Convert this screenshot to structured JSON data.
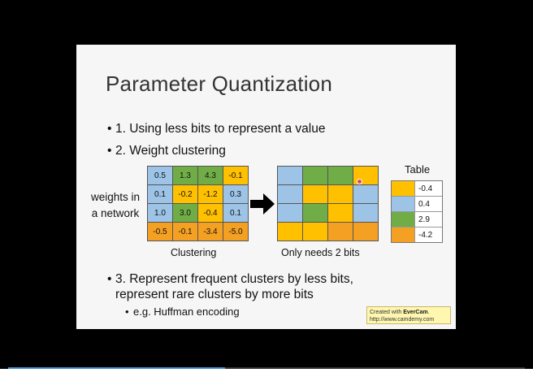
{
  "slide": {
    "title": "Parameter Quantization",
    "bullets": [
      "1. Using less bits to represent a value",
      "2. Weight clustering",
      "3. Represent frequent clusters by less bits,",
      "represent rare clusters by more bits"
    ],
    "sub_bullet": "e.g. Huffman encoding",
    "weights_label_line1": "weights in",
    "weights_label_line2": "a network",
    "clustering_caption": "Clustering",
    "bits_caption": "Only needs 2 bits",
    "table_title": "Table"
  },
  "weights_grid": [
    [
      {
        "v": "0.5",
        "c": "blue"
      },
      {
        "v": "1.3",
        "c": "green"
      },
      {
        "v": "4.3",
        "c": "green"
      },
      {
        "v": "-0.1",
        "c": "yellow"
      }
    ],
    [
      {
        "v": "0.1",
        "c": "blue"
      },
      {
        "v": "-0.2",
        "c": "yellow"
      },
      {
        "v": "-1.2",
        "c": "yellow"
      },
      {
        "v": "0.3",
        "c": "blue"
      }
    ],
    [
      {
        "v": "1.0",
        "c": "blue"
      },
      {
        "v": "3.0",
        "c": "green"
      },
      {
        "v": "-0.4",
        "c": "yellow"
      },
      {
        "v": "0.1",
        "c": "blue"
      }
    ],
    [
      {
        "v": "-0.5",
        "c": "orange"
      },
      {
        "v": "-0.1",
        "c": "orange"
      },
      {
        "v": "-3.4",
        "c": "orange"
      },
      {
        "v": "-5.0",
        "c": "orange"
      }
    ]
  ],
  "cluster_grid": [
    [
      "blue",
      "green",
      "green",
      "yellow"
    ],
    [
      "blue",
      "yellow",
      "yellow",
      "blue"
    ],
    [
      "blue",
      "green",
      "yellow",
      "blue"
    ],
    [
      "yellow",
      "yellow",
      "orange",
      "orange"
    ]
  ],
  "lookup_table": [
    {
      "color": "yellow",
      "value": "-0.4"
    },
    {
      "color": "blue",
      "value": "0.4"
    },
    {
      "color": "green",
      "value": "2.9"
    },
    {
      "color": "orange",
      "value": "-4.2"
    }
  ],
  "watermark": {
    "prefix": "Created with ",
    "brand": "EverCam",
    "suffix": ".",
    "url": "http://www.camdemy.com"
  },
  "progress": {
    "fraction": 0.42
  },
  "colors": {
    "blue": "#9dc3e6",
    "green": "#70ad47",
    "yellow": "#ffc000",
    "orange": "#f4a022",
    "progress": "#3d8fd0"
  }
}
